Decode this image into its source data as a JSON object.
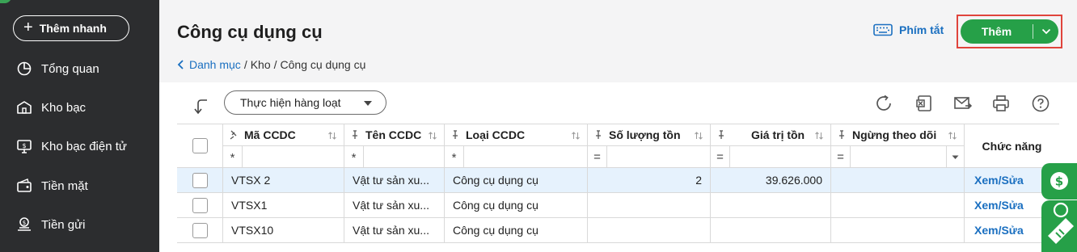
{
  "sidebar": {
    "quick_add": "Thêm nhanh",
    "items": [
      {
        "label": "Tổng quan",
        "icon": "pie-chart-icon"
      },
      {
        "label": "Kho bạc",
        "icon": "bank-icon"
      },
      {
        "label": "Kho bạc điện tử",
        "icon": "monitor-icon"
      },
      {
        "label": "Tiền mặt",
        "icon": "cash-icon"
      },
      {
        "label": "Tiền gửi",
        "icon": "deposit-icon"
      }
    ]
  },
  "header": {
    "title": "Công cụ dụng cụ",
    "breadcrumb": [
      "Danh mục",
      "Kho",
      "Công cụ dụng cụ"
    ],
    "shortcut_label": "Phím tắt",
    "add_label": "Thêm"
  },
  "toolbar": {
    "bulk_action": "Thực hiện hàng loạt"
  },
  "table": {
    "columns": [
      "Mã CCDC",
      "Tên CCDC",
      "Loại CCDC",
      "Số lượng tồn",
      "Giá trị tồn",
      "Ngừng theo dõi",
      "Chức năng"
    ],
    "filter_ops": [
      "*",
      "*",
      "*",
      "=",
      "=",
      "="
    ],
    "rows": [
      {
        "code": "VTSX 2",
        "name": "Vật tư sản xu...",
        "type": "Công cụ dụng cụ",
        "qty": "2",
        "value": "39.626.000",
        "stopped": "",
        "action": "Xem/Sửa"
      },
      {
        "code": "VTSX1",
        "name": "Vật tư sản xu...",
        "type": "Công cụ dụng cụ",
        "qty": "",
        "value": "",
        "stopped": "",
        "action": "Xem/Sửa"
      },
      {
        "code": "VTSX10",
        "name": "Vật tư sản xu...",
        "type": "Công cụ dụng cụ",
        "qty": "",
        "value": "",
        "stopped": "",
        "action": "Xem/Sửa"
      }
    ]
  },
  "colors": {
    "sidebar_bg": "#2c2d2f",
    "accent_green": "#26a048",
    "link_blue": "#1a6fc0",
    "highlight_red": "#e0443c",
    "selected_row": "#e6f2fd"
  }
}
